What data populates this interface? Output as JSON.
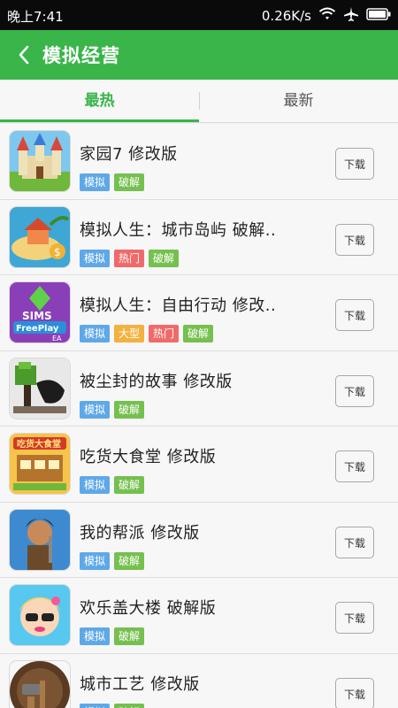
{
  "status": {
    "time": "晚上7:41",
    "speed": "0.26K/s"
  },
  "appbar": {
    "title": "模拟经营"
  },
  "tabs": [
    {
      "label": "最热"
    },
    {
      "label": "最新"
    }
  ],
  "colors": {
    "brand": "#39b54a",
    "tag_sim": "#5fa8e8",
    "tag_crack": "#75c04e",
    "tag_hot": "#f06a6a",
    "tag_large": "#f3b13f"
  },
  "download_label": "下载",
  "apps": [
    {
      "name": "家园7  修改版",
      "icon": "castle-game-icon",
      "tags": [
        {
          "text": "模拟",
          "type": "sim"
        },
        {
          "text": "破解",
          "type": "crack"
        }
      ]
    },
    {
      "name": "模拟人生：城市岛屿  破解..",
      "icon": "island-game-icon",
      "tags": [
        {
          "text": "模拟",
          "type": "sim"
        },
        {
          "text": "热门",
          "type": "hot"
        },
        {
          "text": "破解",
          "type": "crack"
        }
      ]
    },
    {
      "name": "模拟人生：自由行动  修改..",
      "icon": "sims-freeplay-icon",
      "tags": [
        {
          "text": "模拟",
          "type": "sim"
        },
        {
          "text": "大型",
          "type": "large"
        },
        {
          "text": "热门",
          "type": "hot"
        },
        {
          "text": "破解",
          "type": "crack"
        }
      ]
    },
    {
      "name": "被尘封的故事  修改版",
      "icon": "pixel-tree-icon",
      "tags": [
        {
          "text": "模拟",
          "type": "sim"
        },
        {
          "text": "破解",
          "type": "crack"
        }
      ]
    },
    {
      "name": "吃货大食堂  修改版",
      "icon": "restaurant-game-icon",
      "tags": [
        {
          "text": "模拟",
          "type": "sim"
        },
        {
          "text": "破解",
          "type": "crack"
        }
      ]
    },
    {
      "name": "我的帮派  修改版",
      "icon": "gang-game-icon",
      "tags": [
        {
          "text": "模拟",
          "type": "sim"
        },
        {
          "text": "破解",
          "type": "crack"
        }
      ]
    },
    {
      "name": "欢乐盖大楼  破解版",
      "icon": "cartoon-girl-icon",
      "tags": [
        {
          "text": "模拟",
          "type": "sim"
        },
        {
          "text": "破解",
          "type": "crack"
        }
      ]
    },
    {
      "name": "城市工艺  修改版",
      "icon": "city-craft-icon",
      "tags": [
        {
          "text": "模拟",
          "type": "sim"
        },
        {
          "text": "破解",
          "type": "crack"
        }
      ]
    }
  ]
}
